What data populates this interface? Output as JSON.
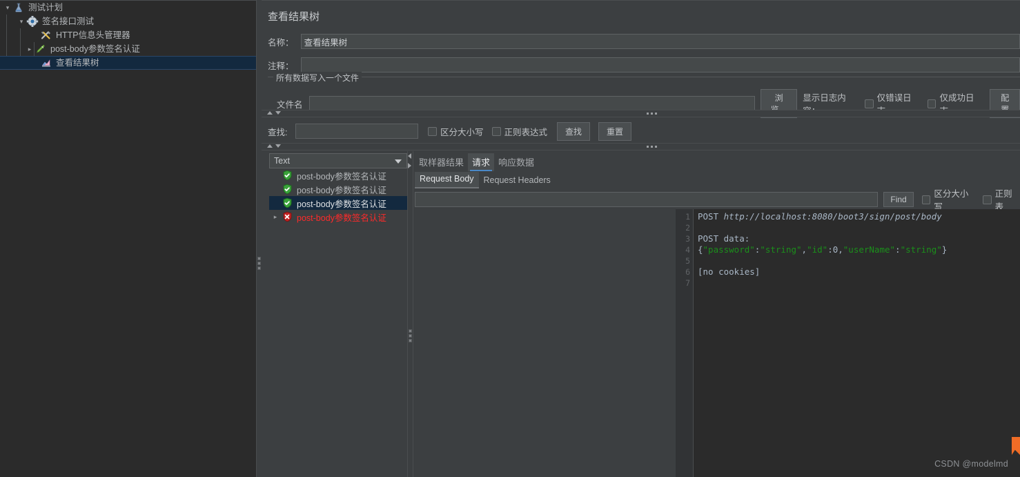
{
  "tree": {
    "items": [
      {
        "label": "测试计划",
        "icon": "flask-icon",
        "depth": 0,
        "twisty": "open",
        "selected": false
      },
      {
        "label": "签名接口测试",
        "icon": "gear-icon",
        "depth": 1,
        "twisty": "open",
        "selected": false
      },
      {
        "label": "HTTP信息头管理器",
        "icon": "tools-icon",
        "depth": 2,
        "twisty": "none",
        "selected": false
      },
      {
        "label": "post-body参数签名认证",
        "icon": "pipette-icon",
        "depth": 2,
        "twisty": "closed",
        "selected": false
      },
      {
        "label": "查看结果树",
        "icon": "graph-icon",
        "depth": 2,
        "twisty": "none",
        "selected": true
      }
    ]
  },
  "main": {
    "title": "查看结果树",
    "name_label": "名称：",
    "name_value": "查看结果树",
    "comment_label": "注释：",
    "comment_value": "",
    "group_legend": "所有数据写入一个文件",
    "filename_label": "文件名",
    "filename_value": "",
    "browse_button": "浏览…",
    "log_display_label": "显示日志内容：",
    "error_only_label": "仅错误日志",
    "success_only_label": "仅成功日志",
    "configure_button": "配置"
  },
  "search_bar": {
    "find_label": "查找:",
    "find_value": "",
    "case_sensitive_label": "区分大小写",
    "regex_label": "正则表达式",
    "find_button": "查找",
    "reset_button": "重置"
  },
  "result_list": {
    "render_type": "Text",
    "rows": [
      {
        "label": "post-body参数签名认证",
        "status": "success",
        "selected": false,
        "twisty": "none"
      },
      {
        "label": "post-body参数签名认证",
        "status": "success",
        "selected": false,
        "twisty": "none"
      },
      {
        "label": "post-body参数签名认证",
        "status": "success",
        "selected": true,
        "twisty": "none"
      },
      {
        "label": "post-body参数签名认证",
        "status": "failure",
        "selected": false,
        "twisty": "closed"
      }
    ]
  },
  "detail": {
    "tabs": [
      {
        "label": "取样器结果",
        "active": false
      },
      {
        "label": "请求",
        "active": true
      },
      {
        "label": "响应数据",
        "active": false
      }
    ],
    "subtabs": [
      {
        "label": "Request Body",
        "active": true
      },
      {
        "label": "Request Headers",
        "active": false
      }
    ],
    "find_value": "",
    "find_button": "Find",
    "case_sensitive_label": "区分大小写",
    "regex_label": "正则表"
  },
  "code": {
    "line_numbers": [
      "1",
      "2",
      "3",
      "4",
      "5",
      "6",
      "7"
    ],
    "lines": [
      [
        {
          "t": "POST ",
          "c": "plain"
        },
        {
          "t": "http://localhost:8080/boot3/sign/post/body",
          "c": "url"
        }
      ],
      [
        {
          "t": "",
          "c": "plain"
        }
      ],
      [
        {
          "t": "POST data:",
          "c": "plain"
        }
      ],
      [
        {
          "t": "{",
          "c": "punct"
        },
        {
          "t": "\"password\"",
          "c": "str"
        },
        {
          "t": ":",
          "c": "punct"
        },
        {
          "t": "\"string\"",
          "c": "str"
        },
        {
          "t": ",",
          "c": "punct"
        },
        {
          "t": "\"id\"",
          "c": "str"
        },
        {
          "t": ":0,",
          "c": "punct"
        },
        {
          "t": "\"userName\"",
          "c": "str"
        },
        {
          "t": ":",
          "c": "punct"
        },
        {
          "t": "\"string\"",
          "c": "str"
        },
        {
          "t": "}",
          "c": "punct"
        }
      ],
      [
        {
          "t": "",
          "c": "plain"
        }
      ],
      [
        {
          "t": "[no cookies]",
          "c": "plain"
        }
      ],
      [
        {
          "t": "",
          "c": "plain"
        }
      ]
    ]
  },
  "watermark": {
    "text": "CSDN @modelmd"
  },
  "colors": {
    "background": "#3c3f41",
    "tree_background": "#2b2b2b",
    "selection": "#13293f",
    "accent": "#4a88c7",
    "success": "#3aa33a",
    "failure": "#ff2a2a",
    "string": "#1b8f1b",
    "corner": "#ef6c26"
  }
}
